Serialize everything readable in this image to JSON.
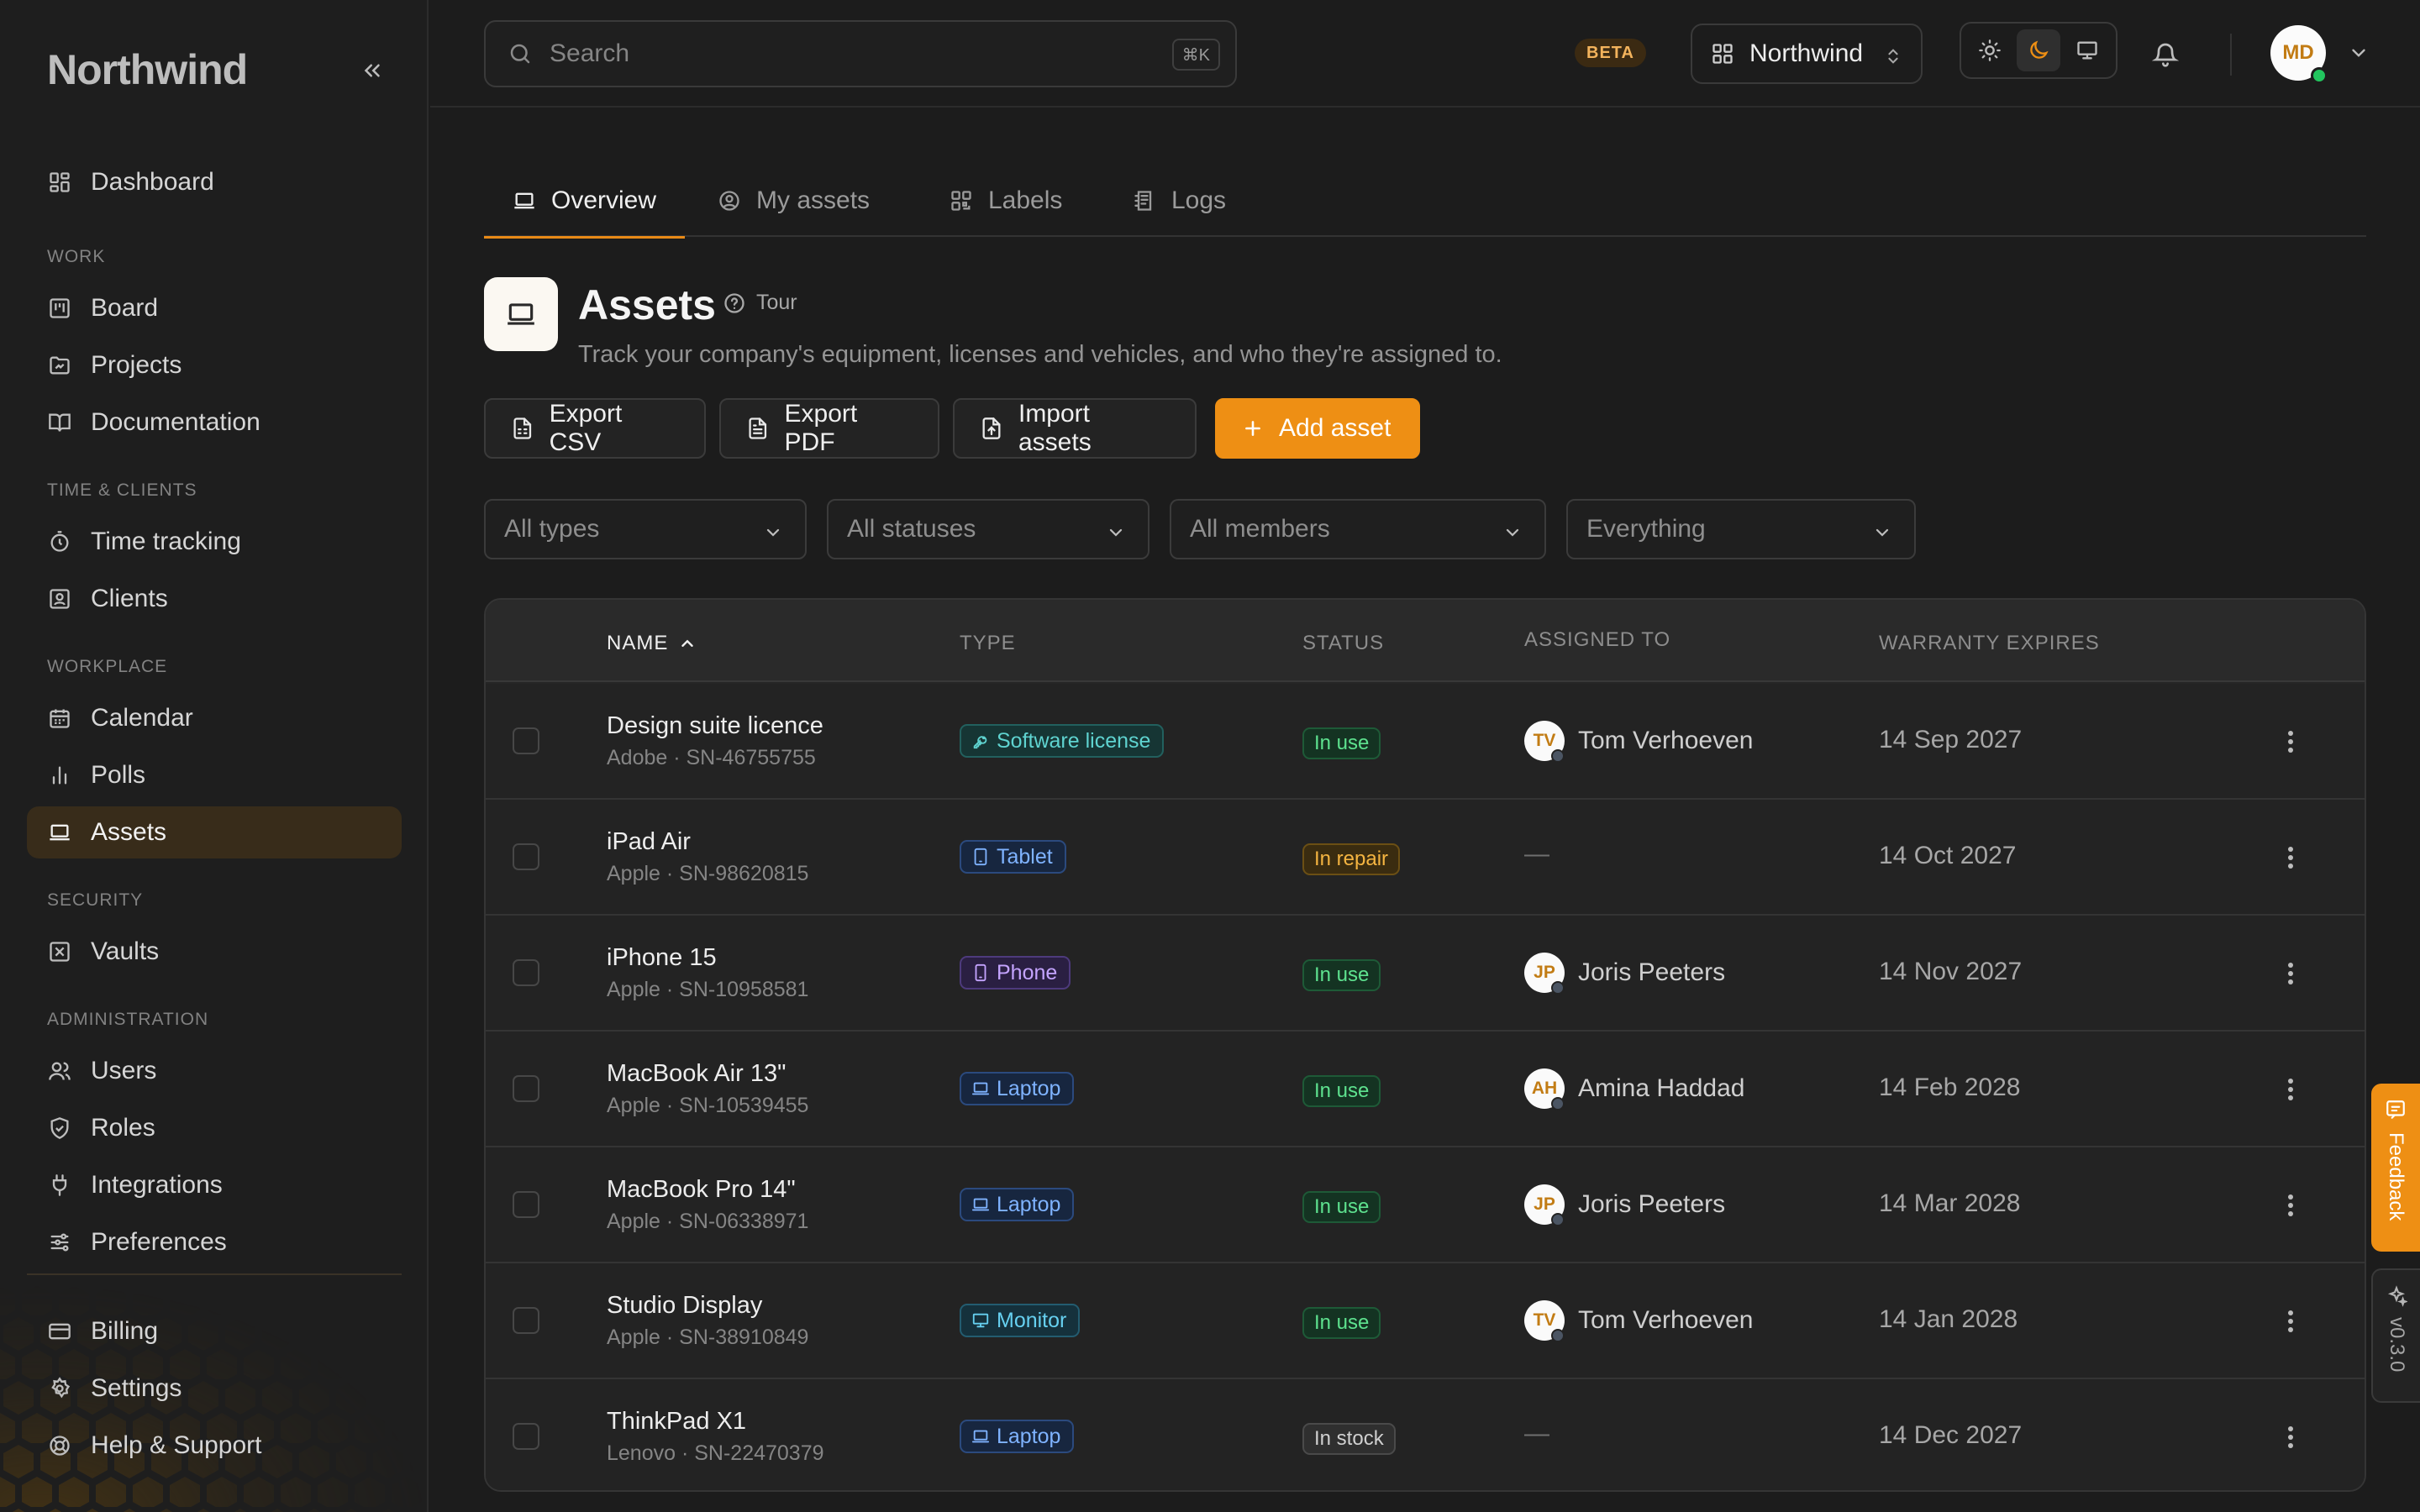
{
  "app": {
    "brand": "Northwind",
    "accent": "#ee8f14"
  },
  "sidebar": {
    "dashboard": "Dashboard",
    "sections": {
      "work": "WORK",
      "time_clients": "TIME & CLIENTS",
      "workplace": "WORKPLACE",
      "security": "SECURITY",
      "administration": "ADMINISTRATION"
    },
    "items": {
      "board": "Board",
      "projects": "Projects",
      "documentation": "Documentation",
      "time_tracking": "Time tracking",
      "clients": "Clients",
      "calendar": "Calendar",
      "polls": "Polls",
      "assets": "Assets",
      "vaults": "Vaults",
      "users": "Users",
      "roles": "Roles",
      "integrations": "Integrations",
      "preferences": "Preferences",
      "billing": "Billing",
      "settings": "Settings",
      "help": "Help & Support"
    },
    "active": "assets"
  },
  "topbar": {
    "search_placeholder": "Search",
    "search_shortcut": "⌘K",
    "beta": "BETA",
    "workspace": "Northwind",
    "theme_selected": "dark",
    "user_initials": "MD"
  },
  "tabs": [
    {
      "label": "Overview",
      "icon": "laptop-icon",
      "active": true
    },
    {
      "label": "My assets",
      "icon": "user-circle-icon",
      "active": false
    },
    {
      "label": "Labels",
      "icon": "qr-code-icon",
      "active": false
    },
    {
      "label": "Logs",
      "icon": "logs-icon",
      "active": false
    }
  ],
  "header": {
    "title": "Assets",
    "tour": "Tour",
    "subtitle": "Track your company's equipment, licenses and vehicles, and who they're assigned to."
  },
  "actions": {
    "export_csv": "Export CSV",
    "export_pdf": "Export PDF",
    "import": "Import assets",
    "add": "Add asset"
  },
  "filters": {
    "types": "All types",
    "statuses": "All statuses",
    "members": "All members",
    "scope": "Everything"
  },
  "table": {
    "columns": {
      "name": "NAME",
      "type": "TYPE",
      "status": "STATUS",
      "assigned": "ASSIGNED TO",
      "warranty": "WARRANTY EXPIRES"
    },
    "sort": "name-ascending",
    "rows": [
      {
        "name": "Design suite licence",
        "meta": "Adobe · SN-46755755",
        "type": "Software license",
        "type_icon": "key-icon",
        "status": "In use",
        "assignee_initials": "TV",
        "assignee": "Tom Verhoeven",
        "warranty": "14 Sep 2027"
      },
      {
        "name": "iPad Air",
        "meta": "Apple · SN-98620815",
        "type": "Tablet",
        "type_icon": "tablet-icon",
        "status": "In repair",
        "assignee_initials": "",
        "assignee": "—",
        "warranty": "14 Oct 2027"
      },
      {
        "name": "iPhone 15",
        "meta": "Apple · SN-10958581",
        "type": "Phone",
        "type_icon": "phone-icon",
        "status": "In use",
        "assignee_initials": "JP",
        "assignee": "Joris Peeters",
        "warranty": "14 Nov 2027"
      },
      {
        "name": "MacBook Air 13\"",
        "meta": "Apple · SN-10539455",
        "type": "Laptop",
        "type_icon": "laptop-icon",
        "status": "In use",
        "assignee_initials": "AH",
        "assignee": "Amina Haddad",
        "warranty": "14 Feb 2028"
      },
      {
        "name": "MacBook Pro 14\"",
        "meta": "Apple · SN-06338971",
        "type": "Laptop",
        "type_icon": "laptop-icon",
        "status": "In use",
        "assignee_initials": "JP",
        "assignee": "Joris Peeters",
        "warranty": "14 Mar 2028"
      },
      {
        "name": "Studio Display",
        "meta": "Apple · SN-38910849",
        "type": "Monitor",
        "type_icon": "monitor-icon",
        "status": "In use",
        "assignee_initials": "TV",
        "assignee": "Tom Verhoeven",
        "warranty": "14 Jan 2028"
      },
      {
        "name": "ThinkPad X1",
        "meta": "Lenovo · SN-22470379",
        "type": "Laptop",
        "type_icon": "laptop-icon",
        "status": "In stock",
        "assignee_initials": "",
        "assignee": "—",
        "warranty": "14 Dec 2027"
      }
    ]
  },
  "float": {
    "feedback": "Feedback",
    "version": "v0.3.0"
  },
  "colors": {
    "type": {
      "Software license": {
        "fg": "#5fd3d0",
        "bg": "#163534",
        "border": "#22605e"
      },
      "Tablet": {
        "fg": "#7fb3ff",
        "bg": "#17263f",
        "border": "#2b4a7e"
      },
      "Phone": {
        "fg": "#c4a4ff",
        "bg": "#2a1f42",
        "border": "#4d3a7c"
      },
      "Laptop": {
        "fg": "#7fb3ff",
        "bg": "#17263f",
        "border": "#2b4a7e"
      },
      "Monitor": {
        "fg": "#66d0f0",
        "bg": "#15313c",
        "border": "#235c70"
      }
    },
    "status": {
      "In use": {
        "fg": "#5ee28f",
        "bg": "#143322",
        "border": "#1e5a37"
      },
      "In repair": {
        "fg": "#f4b441",
        "bg": "#3a2c10",
        "border": "#6b4f14"
      },
      "In stock": {
        "fg": "#d0d0d0",
        "bg": "#2f2f2f",
        "border": "#4a4a4a"
      }
    }
  }
}
